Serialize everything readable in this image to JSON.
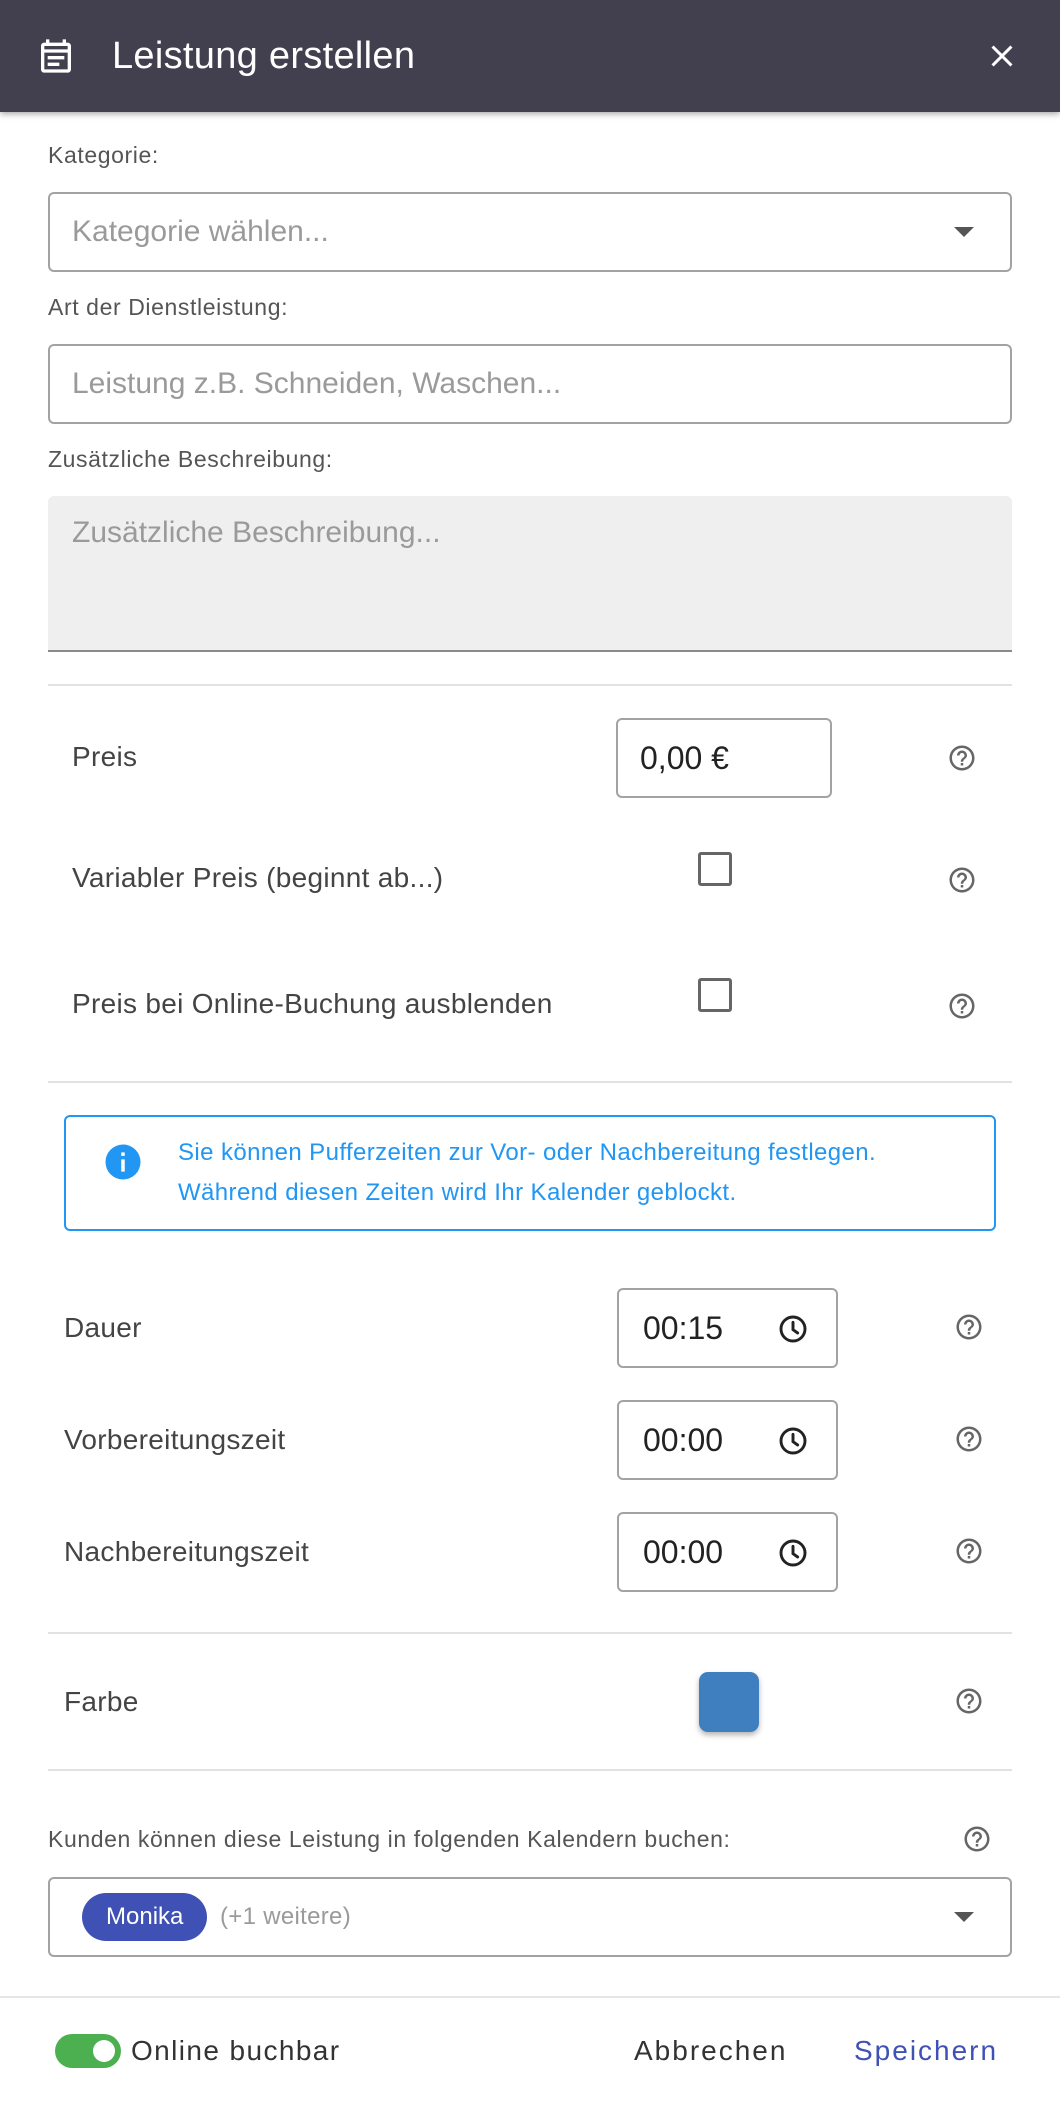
{
  "header": {
    "title": "Leistung erstellen",
    "icon": "calendar-icon",
    "close_icon": "close-icon"
  },
  "form": {
    "category": {
      "label": "Kategorie:",
      "placeholder": "Kategorie wählen..."
    },
    "service": {
      "label": "Art der Dienstleistung:",
      "placeholder": "Leistung z.B. Schneiden, Waschen..."
    },
    "description": {
      "label": "Zusätzliche Beschreibung:",
      "placeholder": "Zusätzliche Beschreibung..."
    }
  },
  "pricing": {
    "price_label": "Preis",
    "price_value": "0,00 €",
    "variable_label": "Variabler Preis (beginnt ab...)",
    "variable_checked": false,
    "hide_label": "Preis bei Online-Buchung ausblenden",
    "hide_checked": false
  },
  "info": {
    "icon": "info-icon",
    "line1": "Sie können Pufferzeiten zur Vor- oder Nachbereitung festlegen.",
    "line2": "Während diesen Zeiten wird Ihr Kalender geblockt."
  },
  "times": [
    {
      "label": "Dauer",
      "value": "00:15"
    },
    {
      "label": "Vorbereitungszeit",
      "value": "00:00"
    },
    {
      "label": "Nachbereitungszeit",
      "value": "00:00"
    }
  ],
  "color": {
    "label": "Farbe",
    "value": "#3f7fbf"
  },
  "calendars": {
    "label": "Kunden können diese Leistung in folgenden Kalendern buchen:",
    "chip": "Monika",
    "more": "(+1 weitere)"
  },
  "footer": {
    "online_label": "Online buchbar",
    "online_enabled": true,
    "cancel_label": "Abbrechen",
    "save_label": "Speichern"
  },
  "colors": {
    "header_bg": "#42404f",
    "accent": "#3f51b5",
    "info": "#2196f3",
    "toggle_on": "#4caf50"
  }
}
